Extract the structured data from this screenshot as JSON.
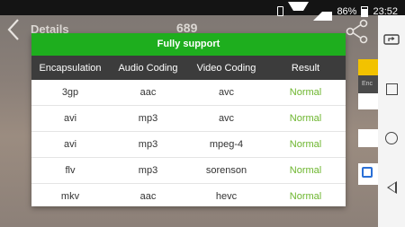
{
  "status_bar": {
    "battery_percent": "86%",
    "time": "23:52",
    "icons": [
      "vibrate-icon",
      "wifi-icon",
      "signal-icon",
      "battery-icon"
    ]
  },
  "app_bar": {
    "title": "Details",
    "score": "689",
    "icons": [
      "back-icon",
      "share-icon"
    ]
  },
  "background_peek": {
    "column_label": "Enc"
  },
  "dialog": {
    "header": "Fully support",
    "header_color": "#1eae1e",
    "columns": [
      "Encapsulation",
      "Audio Coding",
      "Video Coding",
      "Result"
    ],
    "rows": [
      {
        "encapsulation": "3gp",
        "audio": "aac",
        "video": "avc",
        "result": "Normal"
      },
      {
        "encapsulation": "avi",
        "audio": "mp3",
        "video": "avc",
        "result": "Normal"
      },
      {
        "encapsulation": "avi",
        "audio": "mp3",
        "video": "mpeg-4",
        "result": "Normal"
      },
      {
        "encapsulation": "flv",
        "audio": "mp3",
        "video": "sorenson",
        "result": "Normal"
      },
      {
        "encapsulation": "mkv",
        "audio": "aac",
        "video": "hevc",
        "result": "Normal"
      }
    ],
    "result_color": "#6cb52d"
  },
  "nav_bar": {
    "icons": [
      "rotate-screen-icon",
      "recent-apps-icon",
      "home-icon",
      "back-icon"
    ]
  }
}
